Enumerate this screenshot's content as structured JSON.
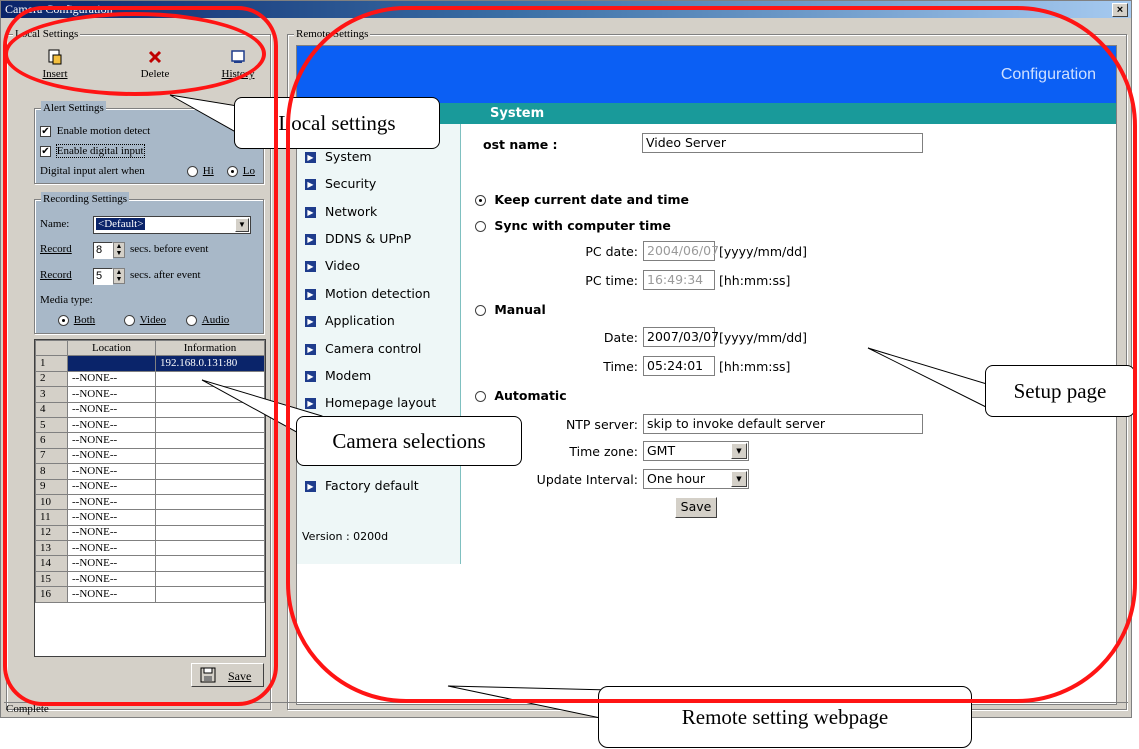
{
  "window": {
    "title": "Camera Configuration",
    "close_label": "×",
    "status": "Complete"
  },
  "local": {
    "legend": "Local Settings",
    "toolbar": {
      "insert": "Insert",
      "delete": "Delete",
      "history": "History"
    },
    "alert": {
      "legend": "Alert Settings",
      "motion": "Enable motion detect",
      "digital": "Enable digital input",
      "when_label": "Digital input alert when",
      "hi": "Hi",
      "lo": "Lo"
    },
    "recording": {
      "legend": "Recording Settings",
      "name_label": "Name:",
      "name_value": "<Default>",
      "record_label": "Record",
      "before_value": "8",
      "before_suffix": "secs. before event",
      "after_value": "5",
      "after_suffix": "secs. after event",
      "media_label": "Media type:",
      "both": "Both",
      "video": "Video",
      "audio": "Audio"
    },
    "table": {
      "col_location": "Location",
      "col_information": "Information",
      "rows": [
        {
          "n": "1",
          "loc": "",
          "info": "192.168.0.131:80"
        },
        {
          "n": "2",
          "loc": "--NONE--",
          "info": ""
        },
        {
          "n": "3",
          "loc": "--NONE--",
          "info": ""
        },
        {
          "n": "4",
          "loc": "--NONE--",
          "info": ""
        },
        {
          "n": "5",
          "loc": "--NONE--",
          "info": ""
        },
        {
          "n": "6",
          "loc": "--NONE--",
          "info": ""
        },
        {
          "n": "7",
          "loc": "--NONE--",
          "info": ""
        },
        {
          "n": "8",
          "loc": "--NONE--",
          "info": ""
        },
        {
          "n": "9",
          "loc": "--NONE--",
          "info": ""
        },
        {
          "n": "10",
          "loc": "--NONE--",
          "info": ""
        },
        {
          "n": "11",
          "loc": "--NONE--",
          "info": ""
        },
        {
          "n": "12",
          "loc": "--NONE--",
          "info": ""
        },
        {
          "n": "13",
          "loc": "--NONE--",
          "info": ""
        },
        {
          "n": "14",
          "loc": "--NONE--",
          "info": ""
        },
        {
          "n": "15",
          "loc": "--NONE--",
          "info": ""
        },
        {
          "n": "16",
          "loc": "--NONE--",
          "info": ""
        }
      ]
    },
    "save": "Save"
  },
  "remote": {
    "legend": "Remote Settings",
    "banner": "Configuration",
    "section": "System",
    "menu": [
      "System",
      "Security",
      "Network",
      "DDNS & UPnP",
      "Video",
      "Motion detection",
      "Application",
      "Camera control",
      "Modem",
      "Homepage layout",
      "Factory default"
    ],
    "version": "Version : 0200d",
    "form": {
      "host_label": "ost name :",
      "host_value": "Video Server",
      "keep": "Keep current date and time",
      "sync": "Sync with computer time",
      "pc_date_label": "PC date:",
      "pc_date_value": "2004/06/07",
      "date_format": "[yyyy/mm/dd]",
      "pc_time_label": "PC time:",
      "pc_time_value": "16:49:34",
      "time_format": "[hh:mm:ss]",
      "manual": "Manual",
      "date_label": "Date:",
      "date_value": "2007/03/07",
      "time_label": "Time:",
      "time_value": "05:24:01",
      "automatic": "Automatic",
      "ntp_label": "NTP server:",
      "ntp_value": "skip to invoke default server",
      "tz_label": "Time zone:",
      "tz_value": "GMT",
      "interval_label": "Update Interval:",
      "interval_value": "One hour",
      "save": "Save"
    }
  },
  "callouts": {
    "local": "Local settings",
    "camera": "Camera selections",
    "setup": "Setup page",
    "remote": "Remote setting webpage"
  },
  "colors": {
    "banner": "#0b5ff4",
    "section": "#199a9a",
    "annotation": "#ff1414"
  }
}
